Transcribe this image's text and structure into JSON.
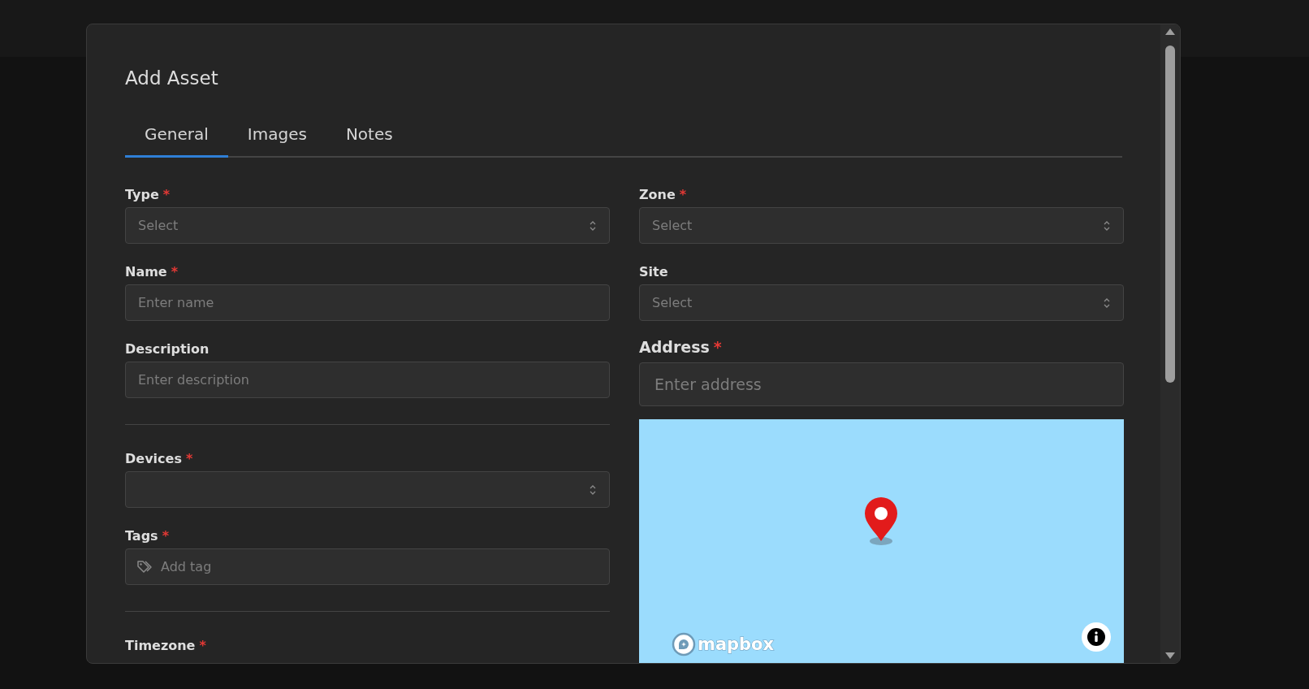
{
  "dialog": {
    "title": "Add Asset",
    "tabs": [
      {
        "label": "General",
        "selected": true
      },
      {
        "label": "Images",
        "selected": false
      },
      {
        "label": "Notes",
        "selected": false
      }
    ],
    "left_fields": [
      {
        "kind": "select",
        "label": "Type",
        "required_mark": "*",
        "placeholder": "Select"
      },
      {
        "kind": "text",
        "label": "Name",
        "required_mark": "*",
        "placeholder": "Enter name"
      },
      {
        "kind": "text",
        "label": "Description",
        "placeholder": "Enter description"
      },
      {
        "kind": "divider"
      },
      {
        "kind": "select",
        "label": "Devices",
        "required_mark": "*"
      },
      {
        "kind": "tags",
        "label": "Tags",
        "required_mark": "*",
        "placeholder": "Add tag"
      },
      {
        "kind": "divider"
      },
      {
        "kind": "heading",
        "label": "Timezone",
        "required_mark": "*"
      }
    ],
    "right_fields": [
      {
        "kind": "select",
        "label": "Zone",
        "required_mark": "*",
        "placeholder": "Select"
      },
      {
        "kind": "select",
        "label": "Site",
        "placeholder": "Select"
      },
      {
        "kind": "large_text",
        "label": "Address",
        "required_mark": "*",
        "placeholder": "Enter address"
      },
      {
        "kind": "map",
        "logo": "mapbox"
      }
    ]
  }
}
